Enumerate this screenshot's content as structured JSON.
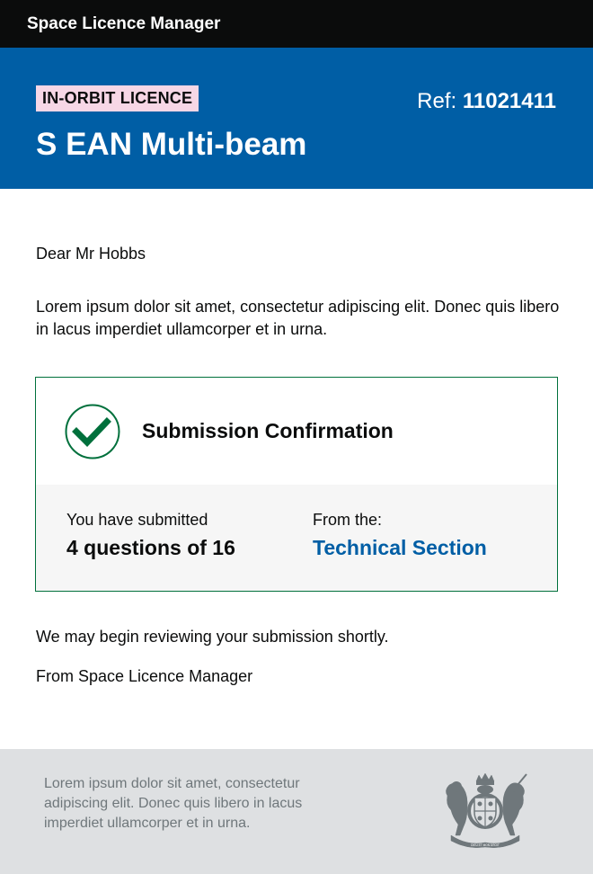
{
  "header": {
    "app_title": "Space Licence Manager"
  },
  "hero": {
    "tag": "IN-ORBIT LICENCE",
    "ref_label": "Ref:",
    "ref_value": "11021411",
    "title": "S EAN Multi-beam"
  },
  "body": {
    "greeting": "Dear Mr Hobbs",
    "intro": "Lorem ipsum dolor sit amet, consectetur adipiscing elit. Donec quis libero in lacus imperdiet ullamcorper et in urna.",
    "review": "We may begin reviewing your submission shortly.",
    "signoff": "From Space Licence Manager"
  },
  "confirmation": {
    "icon": "check-circle-icon",
    "title": "Submission Confirmation",
    "submitted_label": "You have submitted",
    "submitted_value": "4 questions of 16",
    "from_label": "From the:",
    "from_value": "Technical Section"
  },
  "footer": {
    "text": "Lorem ipsum dolor sit amet, consectetur adipiscing elit. Donec quis libero in lacus imperdiet ullamcorper et in urna.",
    "crest": "royal-coat-of-arms-icon",
    "crest_motto": "DIEU ET MON DROIT"
  },
  "colors": {
    "topbar": "#0b0c0c",
    "hero": "#005ea5",
    "tag": "#f7d7e6",
    "success": "#00703c",
    "link": "#005ea5",
    "footer": "#dee0e2",
    "footer_text": "#6f777b"
  }
}
